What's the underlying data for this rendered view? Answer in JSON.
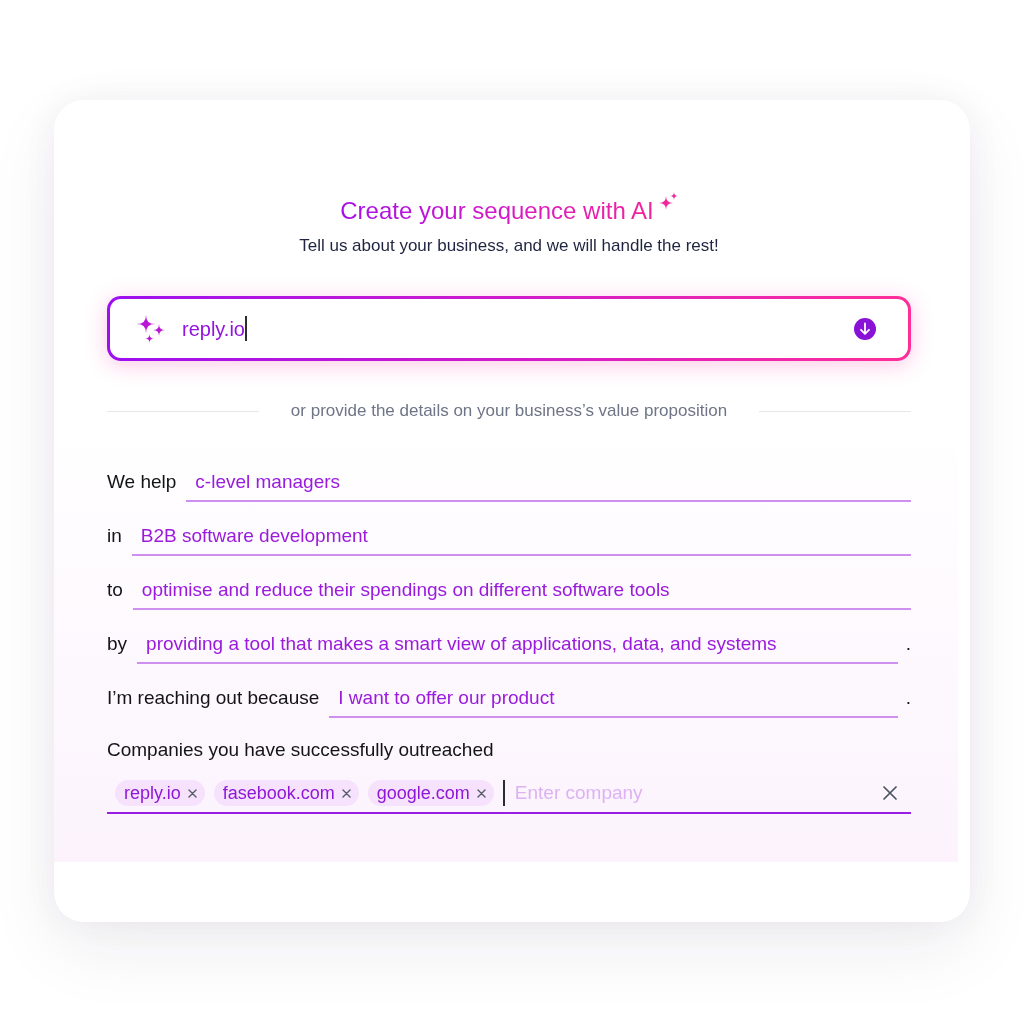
{
  "header": {
    "title": "Create your sequence with AI",
    "subtitle": "Tell us about your business, and we will handle the rest!"
  },
  "prompt_field": {
    "value": "reply.io",
    "focused": true
  },
  "divider": {
    "text": "or provide the details on your business’s value proposition"
  },
  "sentence_rows": [
    {
      "label": "We help",
      "value": "c-level managers"
    },
    {
      "label": "in",
      "value": "B2B software development"
    },
    {
      "label": "to",
      "value": "optimise and reduce their spendings on different software tools"
    },
    {
      "label": "by",
      "value": "providing a tool that makes a smart view of applications, data, and systems",
      "end": "."
    },
    {
      "label": "I’m reaching out because",
      "value": "I want to offer our product",
      "end": "."
    }
  ],
  "companies": {
    "label": "Companies you have successfully outreached",
    "tags": [
      {
        "label": "reply.io"
      },
      {
        "label": "fasebook.com"
      },
      {
        "label": "google.com"
      }
    ],
    "input": {
      "placeholder": "Enter company",
      "focused": true
    }
  }
}
